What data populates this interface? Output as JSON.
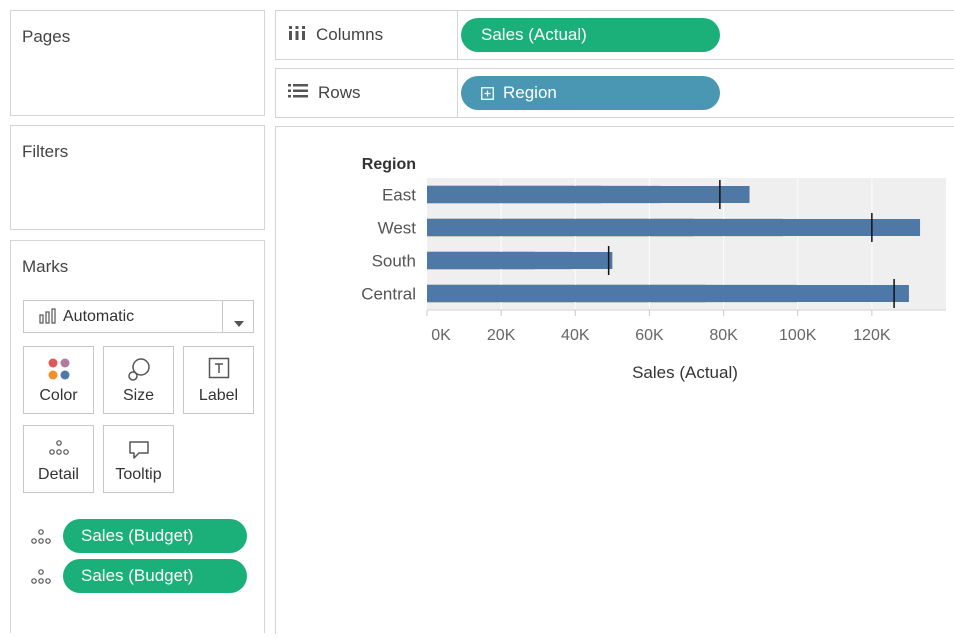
{
  "shelves": {
    "pages_title": "Pages",
    "filters_title": "Filters",
    "marks_title": "Marks",
    "columns_label": "Columns",
    "rows_label": "Rows",
    "columns_pill": "Sales (Actual)",
    "rows_pill": "Region"
  },
  "marks": {
    "mark_type": "Automatic",
    "buttons": {
      "color": "Color",
      "size": "Size",
      "label": "Label",
      "detail": "Detail",
      "tooltip": "Tooltip"
    },
    "detail_pills": [
      "Sales (Budget)",
      "Sales (Budget)"
    ]
  },
  "colors": {
    "green_pill": "#1bb07a",
    "blue_pill": "#4a97b3",
    "bar": "#4e79a7",
    "band_dark": "#c8c8c8",
    "band_mid": "#dadada",
    "band_light": "#efefef"
  },
  "chart_data": {
    "type": "bar",
    "orientation": "horizontal",
    "row_header": "Region",
    "categories": [
      "East",
      "West",
      "South",
      "Central"
    ],
    "series": [
      {
        "name": "Sales (Actual)",
        "values": [
          87000,
          133000,
          50000,
          130000
        ]
      }
    ],
    "reference_lines": [
      79000,
      120000,
      49000,
      126000
    ],
    "bands": [
      {
        "dark": 47000,
        "mid": 63000,
        "light": 140000
      },
      {
        "dark": 72000,
        "mid": 96000,
        "light": 140000
      },
      {
        "dark": 29000,
        "mid": 39000,
        "light": 140000
      },
      {
        "dark": 75000,
        "mid": 100000,
        "light": 140000
      }
    ],
    "xlabel": "Sales (Actual)",
    "xlim": [
      0,
      140000
    ],
    "x_ticks": [
      0,
      20000,
      40000,
      60000,
      80000,
      100000,
      120000
    ],
    "x_tick_labels": [
      "0K",
      "20K",
      "40K",
      "60K",
      "80K",
      "100K",
      "120K"
    ],
    "grid": true
  }
}
